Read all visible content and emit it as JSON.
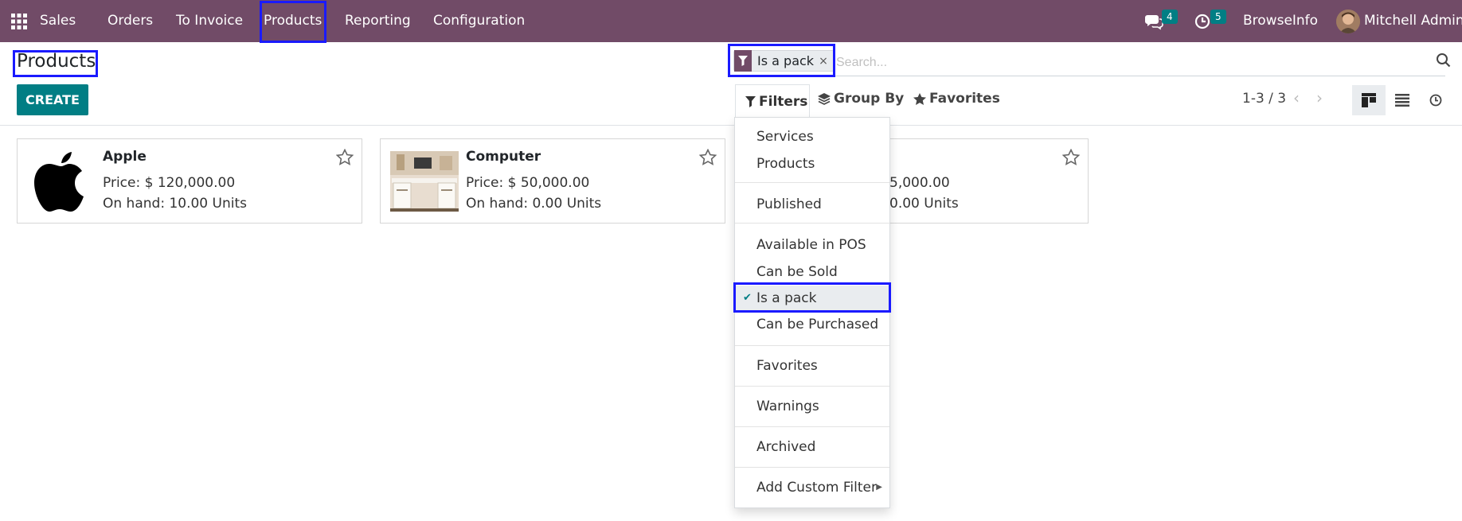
{
  "navbar": {
    "app_name": "Sales",
    "menus": [
      "Orders",
      "To Invoice",
      "Products",
      "Reporting",
      "Configuration"
    ],
    "messages_count": "4",
    "activities_count": "5",
    "company": "BrowseInfo",
    "user": "Mitchell Admin",
    "color": "#714b67"
  },
  "control_panel": {
    "title": "Products",
    "create_label": "CREATE",
    "search": {
      "facet_label": "Is a pack",
      "facet_close": "×",
      "placeholder": "Search..."
    },
    "filters_label": "Filters",
    "groupby_label": "Group By",
    "favorites_label": "Favorites",
    "pager": "1-3 / 3",
    "active_view": "kanban"
  },
  "filters_dropdown": {
    "items": [
      "Services",
      "Products",
      "Published",
      "Available in POS",
      "Can be Sold",
      "Is a pack",
      "Can be Purchased",
      "Favorites",
      "Warnings",
      "Archived",
      "Add Custom Filter"
    ],
    "selected": "Is a pack"
  },
  "products": [
    {
      "name": "Apple",
      "price": "Price: $ 120,000.00",
      "on_hand": "On hand: 10.00 Units",
      "image": "apple-logo"
    },
    {
      "name": "Computer",
      "price": "Price: $ 50,000.00",
      "on_hand": "On hand: 0.00 Units",
      "image": "desk-photo"
    },
    {
      "name": "",
      "price": "5,000.00",
      "on_hand": "0.00 Units",
      "image": ""
    }
  ],
  "accent_color": "#017e84",
  "highlight_color": "#1a1aff"
}
